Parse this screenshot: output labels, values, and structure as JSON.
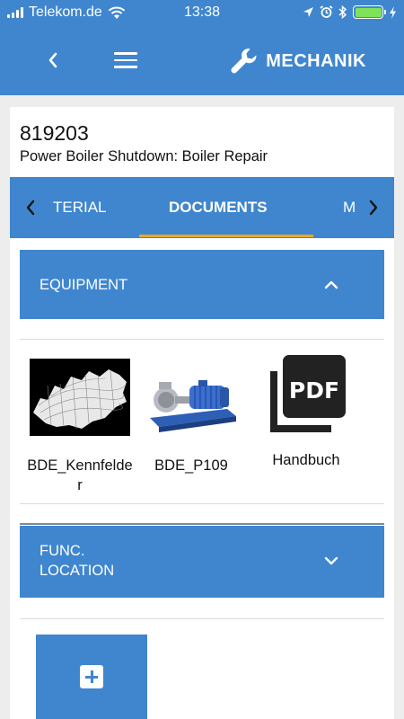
{
  "status_bar": {
    "carrier": "Telekom.de",
    "time": "13:38",
    "icons": [
      "signal-icon",
      "wifi-icon",
      "location-arrow-icon",
      "alarm-icon",
      "bluetooth-icon",
      "battery-icon",
      "charging-bolt-icon"
    ],
    "battery_level": 1.0
  },
  "app_bar": {
    "back_icon": "chevron-left-icon",
    "menu_icon": "hamburger-menu-icon",
    "brand_icon": "wrench-icon",
    "brand_label": "MECHANIK"
  },
  "order": {
    "number": "819203",
    "title": "Power Boiler Shutdown: Boiler Repair"
  },
  "tabs": {
    "items": [
      {
        "label": "TERIAL",
        "active": false
      },
      {
        "label": "DOCUMENTS",
        "active": true
      },
      {
        "label": "M",
        "active": false
      }
    ],
    "left_arrow_icon": "chevron-left-icon",
    "right_arrow_icon": "chevron-right-icon",
    "underline_color": "#e3ab2c"
  },
  "sections": {
    "equipment": {
      "title": "EQUIPMENT",
      "chevron": "chevron-up-icon",
      "expanded": true
    },
    "func_location": {
      "title": "FUNC. LOCATION",
      "chevron": "chevron-down-icon",
      "expanded": false
    }
  },
  "documents": [
    {
      "caption": "BDE_Kennfelder",
      "thumbnail": "contour-map-thumbnail"
    },
    {
      "caption": "BDE_P109",
      "thumbnail": "pump-thumbnail"
    },
    {
      "caption": "Handbuch",
      "thumbnail": "pdf-icon"
    }
  ],
  "pdf_icon_label": "PDF",
  "add_button": {
    "icon": "plus-box-icon"
  },
  "colors": {
    "primary": "#3f86cf",
    "background": "#ededed",
    "card": "#ffffff",
    "accent": "#e3ab2c",
    "battery": "#7ee35a"
  }
}
